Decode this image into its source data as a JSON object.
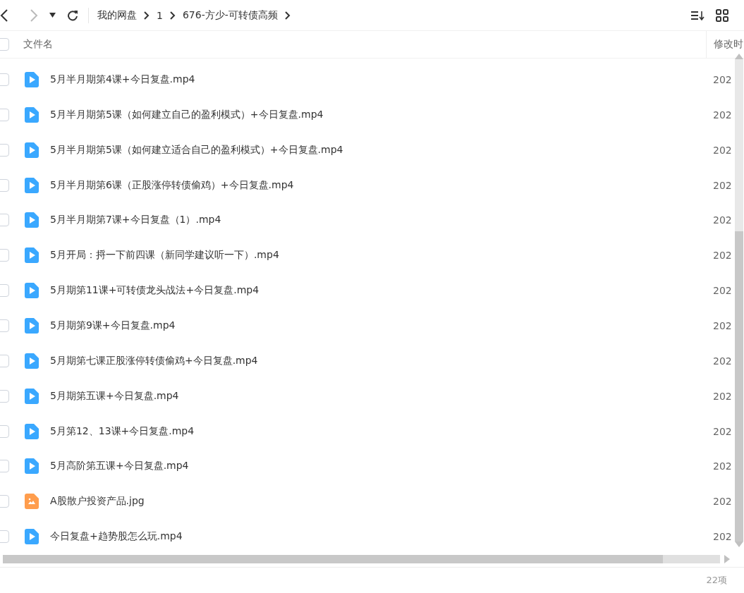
{
  "breadcrumb": [
    "我的网盘",
    "1",
    "676-方少-可转债高频"
  ],
  "header": {
    "checked": false,
    "name": "文件名",
    "modified": "修改时"
  },
  "files": [
    {
      "kind": "video",
      "name": "5月半月期第4课+今日复盘.mp4",
      "modified": "202",
      "checked": false
    },
    {
      "kind": "video",
      "name": "5月半月期第5课（如何建立自己的盈利模式）+今日复盘.mp4",
      "modified": "202",
      "checked": false
    },
    {
      "kind": "video",
      "name": "5月半月期第5课（如何建立适合自己的盈利模式）+今日复盘.mp4",
      "modified": "202",
      "checked": false
    },
    {
      "kind": "video",
      "name": "5月半月期第6课（正股涨停转债偷鸡）+今日复盘.mp4",
      "modified": "202",
      "checked": false
    },
    {
      "kind": "video",
      "name": "5月半月期第7课+今日复盘（1）.mp4",
      "modified": "202",
      "checked": false
    },
    {
      "kind": "video",
      "name": "5月开局：捋一下前四课（新同学建议听一下）.mp4",
      "modified": "202",
      "checked": false
    },
    {
      "kind": "video",
      "name": "5月期第11课+可转债龙头战法+今日复盘.mp4",
      "modified": "202",
      "checked": false
    },
    {
      "kind": "video",
      "name": "5月期第9课+今日复盘.mp4",
      "modified": "202",
      "checked": false
    },
    {
      "kind": "video",
      "name": "5月期第七课正股涨停转债偷鸡+今日复盘.mp4",
      "modified": "202",
      "checked": false
    },
    {
      "kind": "video",
      "name": "5月期第五课+今日复盘.mp4",
      "modified": "202",
      "checked": false
    },
    {
      "kind": "video",
      "name": "5月第12、13课+今日复盘.mp4",
      "modified": "202",
      "checked": false
    },
    {
      "kind": "video",
      "name": "5月高阶第五课+今日复盘.mp4",
      "modified": "202",
      "checked": false
    },
    {
      "kind": "image",
      "name": "A股散户投资产品.jpg",
      "modified": "202",
      "checked": false
    },
    {
      "kind": "video",
      "name": "今日复盘+趋势股怎么玩.mp4",
      "modified": "202",
      "checked": false
    }
  ],
  "status": "22项"
}
